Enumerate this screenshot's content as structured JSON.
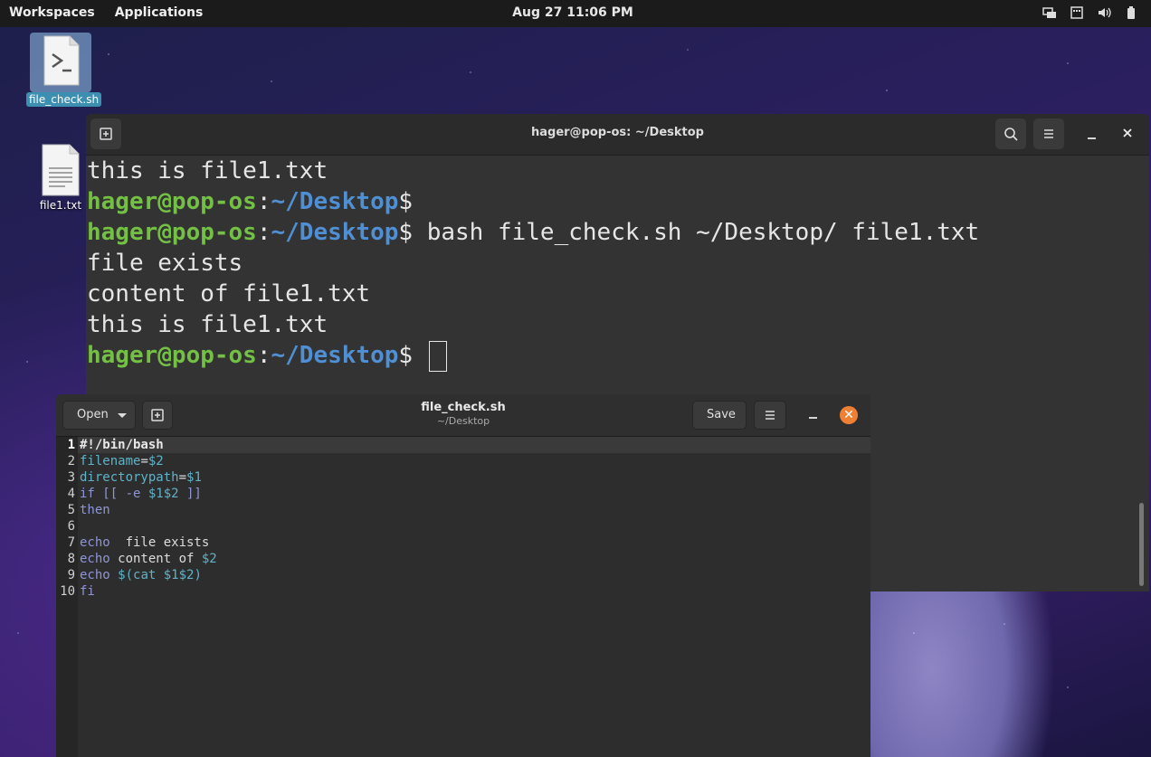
{
  "topbar": {
    "workspaces": "Workspaces",
    "applications": "Applications",
    "clock": "Aug 27  11:06 PM",
    "tray_icons": [
      "screen-share-icon",
      "keyboard-icon",
      "volume-icon",
      "battery-icon"
    ]
  },
  "desktop": {
    "icons": [
      {
        "label": "file_check.sh",
        "icon": "script-icon"
      },
      {
        "label": "file1.txt",
        "icon": "text-file-icon"
      }
    ]
  },
  "terminal": {
    "title": "hager@pop-os: ~/Desktop",
    "lines": [
      {
        "type": "out",
        "text": "this is file1.txt"
      },
      {
        "type": "prompt",
        "user": "hager@pop-os",
        "sep": ":",
        "path": "~/Desktop",
        "sym": "$",
        "cmd": ""
      },
      {
        "type": "prompt",
        "user": "hager@pop-os",
        "sep": ":",
        "path": "~/Desktop",
        "sym": "$",
        "cmd": " bash file_check.sh ~/Desktop/ file1.txt"
      },
      {
        "type": "out",
        "text": "file exists"
      },
      {
        "type": "out",
        "text": "content of file1.txt"
      },
      {
        "type": "out",
        "text": "this is file1.txt"
      },
      {
        "type": "prompt",
        "user": "hager@pop-os",
        "sep": ":",
        "path": "~/Desktop",
        "sym": "$",
        "cmd": " ",
        "cursor": true
      }
    ]
  },
  "editor": {
    "open_label": "Open",
    "save_label": "Save",
    "filename": "file_check.sh",
    "directory": "~/Desktop",
    "line_numbers": [
      "1",
      "2",
      "3",
      "4",
      "5",
      "6",
      "7",
      "8",
      "9",
      "10"
    ],
    "code_lines": [
      [
        {
          "t": "#!/bin/bash",
          "c": "bold"
        }
      ],
      [
        {
          "t": "filename",
          "c": "var"
        },
        {
          "t": "=",
          "c": ""
        },
        {
          "t": "$2",
          "c": "var"
        }
      ],
      [
        {
          "t": "directorypath",
          "c": "var"
        },
        {
          "t": "=",
          "c": ""
        },
        {
          "t": "$1",
          "c": "var"
        }
      ],
      [
        {
          "t": "if [[ -e ",
          "c": "kw"
        },
        {
          "t": "$1$2",
          "c": "var"
        },
        {
          "t": " ]]",
          "c": "kw"
        }
      ],
      [
        {
          "t": "then",
          "c": "kw"
        }
      ],
      [],
      [
        {
          "t": "echo",
          "c": "kw"
        },
        {
          "t": "  file exists",
          "c": ""
        }
      ],
      [
        {
          "t": "echo",
          "c": "kw"
        },
        {
          "t": " content of ",
          "c": ""
        },
        {
          "t": "$2",
          "c": "var"
        }
      ],
      [
        {
          "t": "echo",
          "c": "kw"
        },
        {
          "t": " ",
          "c": ""
        },
        {
          "t": "$(cat $1$2)",
          "c": "var"
        }
      ],
      [
        {
          "t": "fi",
          "c": "kw"
        }
      ]
    ]
  }
}
